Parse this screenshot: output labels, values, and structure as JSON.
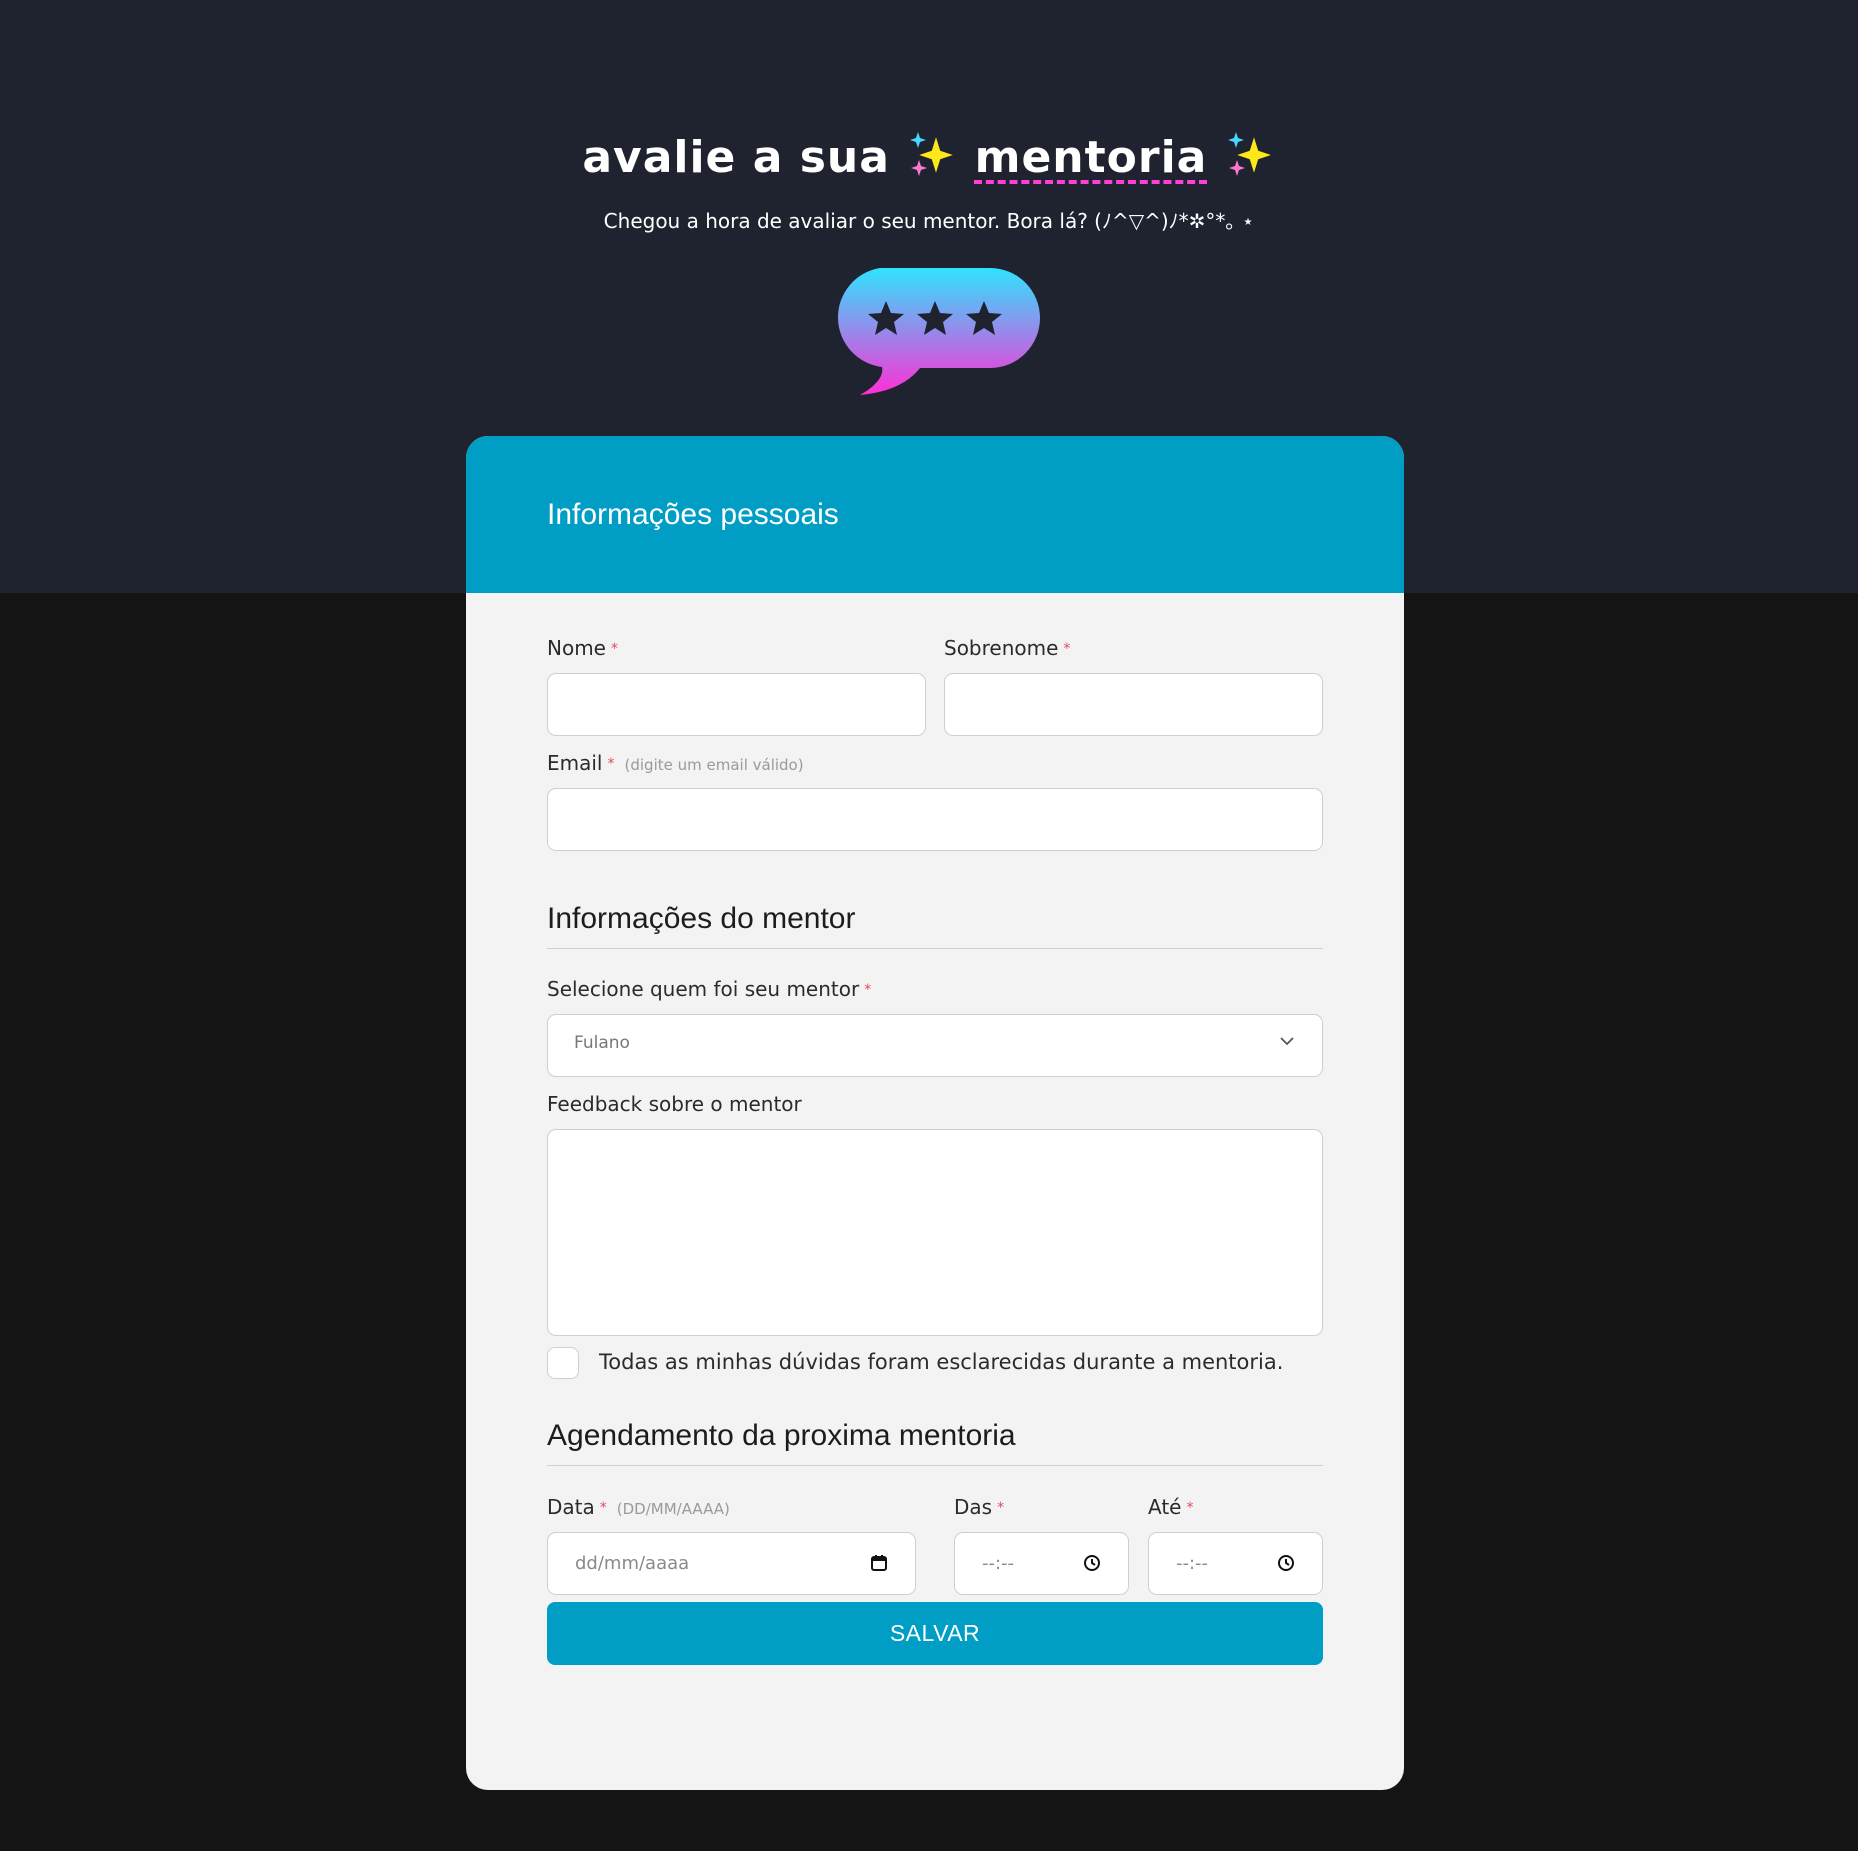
{
  "hero": {
    "title_prefix": "avalie a sua",
    "title_accent": "mentoria",
    "subtitle": "Chegou a hora de avaliar o seu mentor. Bora lá? (ﾉ^▽^)ﾉ*✲°*｡ ⋆"
  },
  "form": {
    "personal_section_title": "Informações pessoais",
    "first_name_label": "Nome",
    "last_name_label": "Sobrenome",
    "email_label": "Email",
    "email_hint": "(digite um email válido)",
    "mentor_section_title": "Informações do mentor",
    "mentor_select_label": "Selecione quem foi seu mentor",
    "mentor_select_value": "Fulano",
    "feedback_label": "Feedback sobre o mentor",
    "checkbox_label": "Todas as minhas dúvidas foram esclarecidas durante a mentoria.",
    "schedule_section_title": "Agendamento da proxima mentoria",
    "date_label": "Data",
    "date_hint": "(DD/MM/AAAA)",
    "date_placeholder": "dd/mm/aaaa",
    "from_label": "Das",
    "to_label": "Até",
    "time_placeholder": "--:--",
    "required_mark": "*",
    "save_label": "SALVAR"
  },
  "colors": {
    "accent": "#009dc4",
    "top_background": "#1f2330",
    "page_background": "#141414",
    "card_background": "#f3f3f3",
    "required": "#e5485c",
    "underline": "#ff3fd8"
  },
  "icons": [
    "sparkles-icon",
    "rating-bubble-icon",
    "star-icon",
    "chevron-down-icon",
    "calendar-icon",
    "clock-icon"
  ]
}
